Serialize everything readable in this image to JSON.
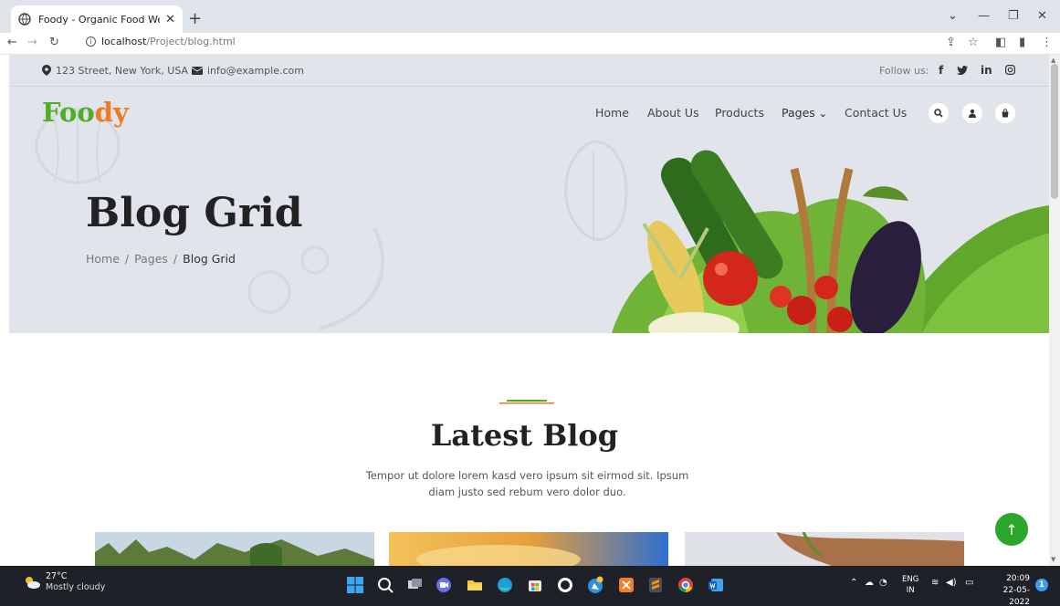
{
  "browser": {
    "tab_title": "Foody - Organic Food Website Te",
    "url_host": "localhost",
    "url_path": "/Project/blog.html"
  },
  "topbar": {
    "address": "123 Street, New York, USA",
    "email": "info@example.com",
    "follow_label": "Follow us:",
    "social": [
      "f",
      "in"
    ]
  },
  "header": {
    "logo_part1": "Foo",
    "logo_part2": "dy",
    "menu": [
      "Home",
      "About Us",
      "Products",
      "Pages",
      "Contact Us"
    ],
    "pages_caret": "⌄"
  },
  "hero": {
    "title": "Blog Grid",
    "breadcrumb": [
      "Home",
      "Pages",
      "Blog Grid"
    ],
    "separator": "/"
  },
  "section": {
    "title": "Latest Blog",
    "text": "Tempor ut dolore lorem kasd vero ipsum sit eirmod sit. Ipsum diam justo sed rebum vero dolor duo."
  },
  "taskbar": {
    "temp": "27°C",
    "condition": "Mostly cloudy",
    "lang_top": "ENG",
    "lang_bottom": "IN",
    "time": "20:09",
    "date": "22-05-2022",
    "notif_count": "1"
  },
  "colors": {
    "logo_green": "#4caf27",
    "logo_orange": "#f07a22",
    "back_to_top": "#2aa629",
    "hero_bg": "#e1e4ea",
    "taskbar_bg": "#1f2129"
  },
  "icons": [
    "map-marker-icon",
    "envelope-icon",
    "search-icon",
    "user-icon",
    "shopping-bag-icon",
    "arrow-up-icon"
  ]
}
